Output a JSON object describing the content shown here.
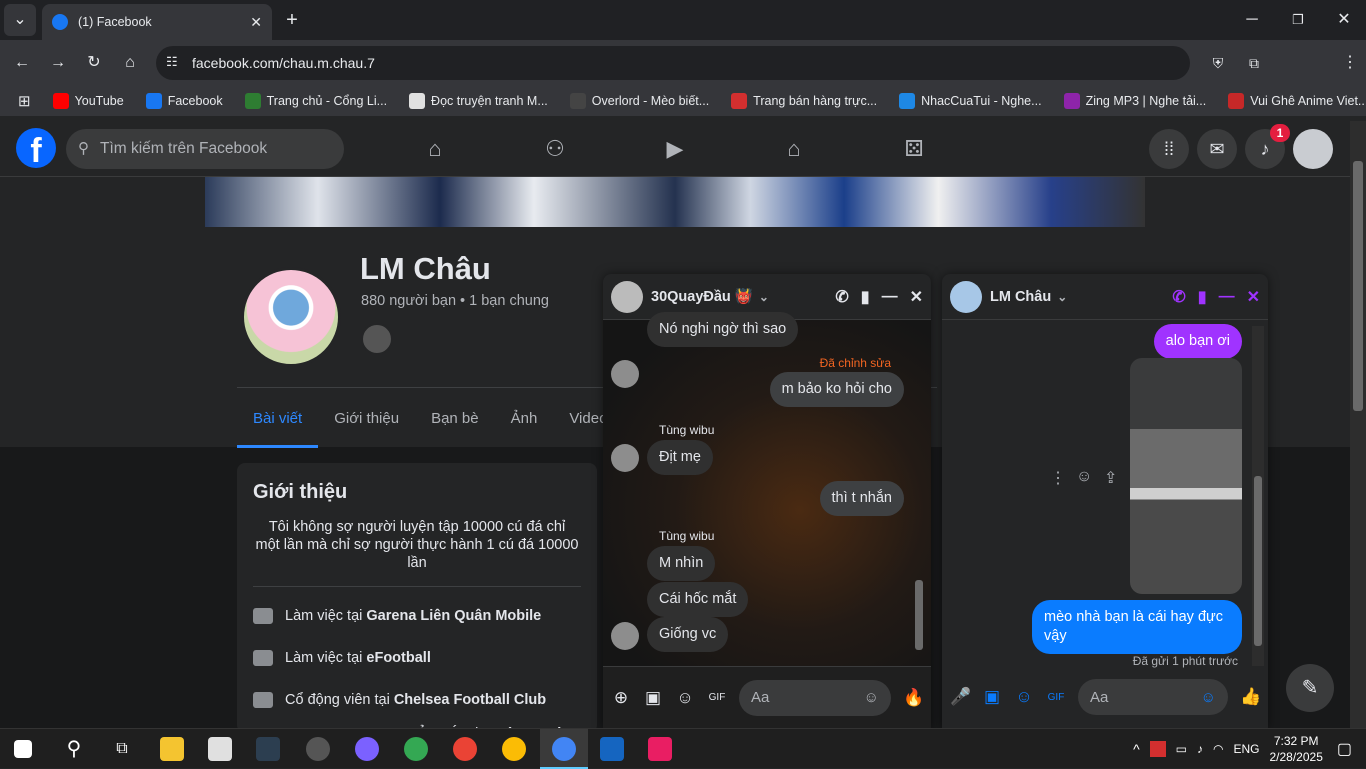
{
  "browser": {
    "tab_title": "(1) Facebook",
    "url": "facebook.com/chau.m.chau.7",
    "bookmarks": [
      {
        "label": "YouTube",
        "color": "#ff0000"
      },
      {
        "label": "Facebook",
        "color": "#1877f2"
      },
      {
        "label": "Trang chủ - Cổng Li...",
        "color": "#2e7d32"
      },
      {
        "label": "Đọc truyện tranh M...",
        "color": "#e0e0e0"
      },
      {
        "label": "Overlord - Mèo biết...",
        "color": "#444444"
      },
      {
        "label": "Trang bán hàng trực...",
        "color": "#d32f2f"
      },
      {
        "label": "NhacCuaTui - Nghe...",
        "color": "#1e88e5"
      },
      {
        "label": "Zing MP3 | Nghe tải...",
        "color": "#8e24aa"
      },
      {
        "label": "Vui Ghê Anime Viet...",
        "color": "#c62828"
      }
    ]
  },
  "fb": {
    "search_placeholder": "Tìm kiếm trên Facebook",
    "notification_count": "1"
  },
  "profile": {
    "name": "LM Châu",
    "friends": "880 người bạn • 1 bạn chung",
    "tabs": [
      "Bài viết",
      "Giới thiệu",
      "Bạn bè",
      "Ảnh",
      "Video"
    ],
    "intro_title": "Giới thiệu",
    "bio": "Tôi không sợ người luyện tập 10000 cú đá chỉ một lần mà chỉ sợ người thực hành 1 cú đá 10000 lần",
    "intro_items": [
      {
        "prefix": "Làm việc tại ",
        "bold": "Garena Liên Quân Mobile"
      },
      {
        "prefix": "Làm việc tại ",
        "bold": "eFootball"
      },
      {
        "prefix": "Cổ động viên tại ",
        "bold": "Chelsea Football Club"
      },
      {
        "prefix": "Học KHOA HỌC QUẢN LÝ tại ",
        "bold": "Trường Đại học"
      }
    ]
  },
  "chat1": {
    "title": "30QuayĐầu 👹",
    "messages": {
      "m0": "Nó nghi ngờ thì sao",
      "edited": "Đã chỉnh sửa",
      "m1": "m bảo ko hỏi cho",
      "sender1": "Tùng wibu",
      "m2": "Địt mẹ",
      "m3": "thì t nhắn",
      "sender2": "Tùng wibu",
      "m4": "M nhìn",
      "m5": "Cái hốc mắt",
      "m6": "Giống vc"
    },
    "input_placeholder": "Aa"
  },
  "chat2": {
    "title": "LM Châu",
    "messages": {
      "m1": "alo bạn ơi",
      "m2": "mèo nhà bạn là cái hay đực vậy",
      "status": "Đã gửi 1 phút trước"
    },
    "input_placeholder": "Aa"
  },
  "taskbar": {
    "time": "7:32 PM",
    "date": "2/28/2025",
    "lang": "ENG"
  }
}
